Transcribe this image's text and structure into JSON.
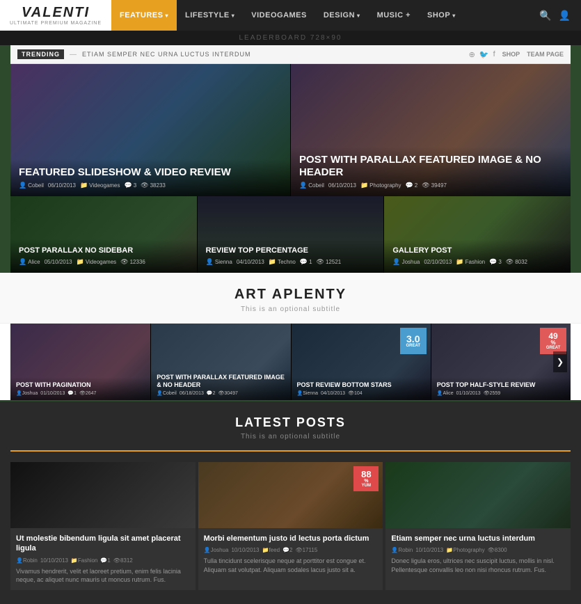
{
  "header": {
    "logo": "VALENTI",
    "logo_sub": "ULTIMATE PREMIUM MAGAZINE",
    "nav": [
      {
        "label": "FEATURES",
        "arrow": "▾",
        "active": true
      },
      {
        "label": "LIFESTYLE",
        "arrow": "▾",
        "active": false
      },
      {
        "label": "VIDEOGAMES",
        "arrow": "",
        "active": false
      },
      {
        "label": "DESIGN",
        "arrow": "▾",
        "active": false
      },
      {
        "label": "MUSIC +",
        "arrow": "",
        "active": false
      },
      {
        "label": "SHOP",
        "arrow": "▾",
        "active": false
      }
    ],
    "leaderboard": "LEADERBOARD 728×90"
  },
  "trending": {
    "label": "TRENDING",
    "dash": "—",
    "text": "ETIAM SEMPER NEC URNA LUCTUS INTERDUM",
    "links": [
      "SHOP",
      "TEAM PAGE"
    ]
  },
  "featured": [
    {
      "id": "feat1",
      "title": "FEATURED SLIDESHOW & VIDEO REVIEW",
      "author": "Cobeil",
      "date": "06/10/2013",
      "category": "Videogames",
      "comments": "3",
      "views": "38233",
      "img_class": "fake-img-person"
    },
    {
      "id": "feat2",
      "title": "POST WITH PARALLAX FEATURED IMAGE & NO HEADER",
      "author": "Cobeil",
      "date": "06/10/2013",
      "category": "Photography",
      "comments": "2",
      "views": "39497",
      "img_class": "fake-img-woman"
    },
    {
      "id": "feat3",
      "title": "POST PARALLAX NO SIDEBAR",
      "author": "Alice",
      "date": "05/10/2013",
      "category": "Videogames",
      "comments": "",
      "views": "12336",
      "img_class": "fake-img-forest"
    },
    {
      "id": "feat4",
      "title": "REVIEW TOP PERCENTAGE",
      "author": "Sienna",
      "date": "04/10/2013",
      "category": "Techno",
      "comments": "1",
      "views": "12521",
      "img_class": "fake-img-figure"
    },
    {
      "id": "feat5",
      "title": "GALLERY POST",
      "author": "Joshua",
      "date": "02/10/2013",
      "category": "Fashion",
      "comments": "3",
      "views": "8032",
      "img_class": "fake-img-flowers"
    }
  ],
  "art_aplenty": {
    "title": "ART APLENTY",
    "subtitle": "This is an optional subtitle"
  },
  "carousel": {
    "items": [
      {
        "title": "POST WITH PAGINATION",
        "author": "Joshua",
        "date": "01/10/2013",
        "comments": "1",
        "views": "2647",
        "img_class": "img-carousel1",
        "badge": null
      },
      {
        "title": "POST WITH PARALLAX FEATURED IMAGE & NO HEADER",
        "author": "Cobeil",
        "date": "06/18/2013",
        "comments": "2",
        "views": "30497",
        "img_class": "img-carousel2",
        "badge": null
      },
      {
        "title": "POST REVIEW BOTTOM STARS",
        "author": "Sienna",
        "date": "04/10/2013",
        "comments": "",
        "views": "104",
        "img_class": "img-carousel3",
        "badge_score": "3.0",
        "badge_label": "GREAT"
      },
      {
        "title": "POST TOP HALF-STYLE REVIEW",
        "author": "Alice",
        "date": "01/10/2013",
        "comments": "",
        "views": "2559",
        "img_class": "img-carousel4",
        "badge_pct": "49",
        "badge_label": "GREAT"
      }
    ]
  },
  "latest": {
    "title": "LATEST POSTS",
    "subtitle": "This is an optional subtitle",
    "posts": [
      {
        "thumb_class": "img-dark-speaker",
        "title": "Ut molestie bibendum ligula sit amet placerat ligula",
        "author": "Robin",
        "date": "10/10/2013",
        "category": "Fashion",
        "comments": "1",
        "views": "8312",
        "excerpt": "Vivamus hendrerit, velit et laoreet pretium, enim felis lacinia neque, ac aliquet nunc mauris ut moncus rutrum. Fus.",
        "badge": null
      },
      {
        "thumb_class": "img-food-brown",
        "title": "Morbi elementum justo id lectus porta dictum",
        "author": "Joshua",
        "date": "10/10/2013",
        "category": "feed",
        "comments": "2",
        "views": "17115",
        "excerpt": "Tulla tincidunt scelerisque neque at porttitor est congue et. Aliquam sat volutpat. Aliquam sodales lacus justo sit a.",
        "badge_pct": "88",
        "badge_label": "YUM"
      },
      {
        "thumb_class": "img-mountains",
        "title": "Etiam semper nec urna luctus interdum",
        "author": "Robin",
        "date": "10/10/2013",
        "category": "Photography",
        "comments": "",
        "views": "8300",
        "excerpt": "Donec ligula eros, ultrices nec suscipit luctus, mollis in nisl. Pellentesque convallis leo non nisi rhoncus rutrum. Fus.",
        "badge": null
      }
    ]
  }
}
